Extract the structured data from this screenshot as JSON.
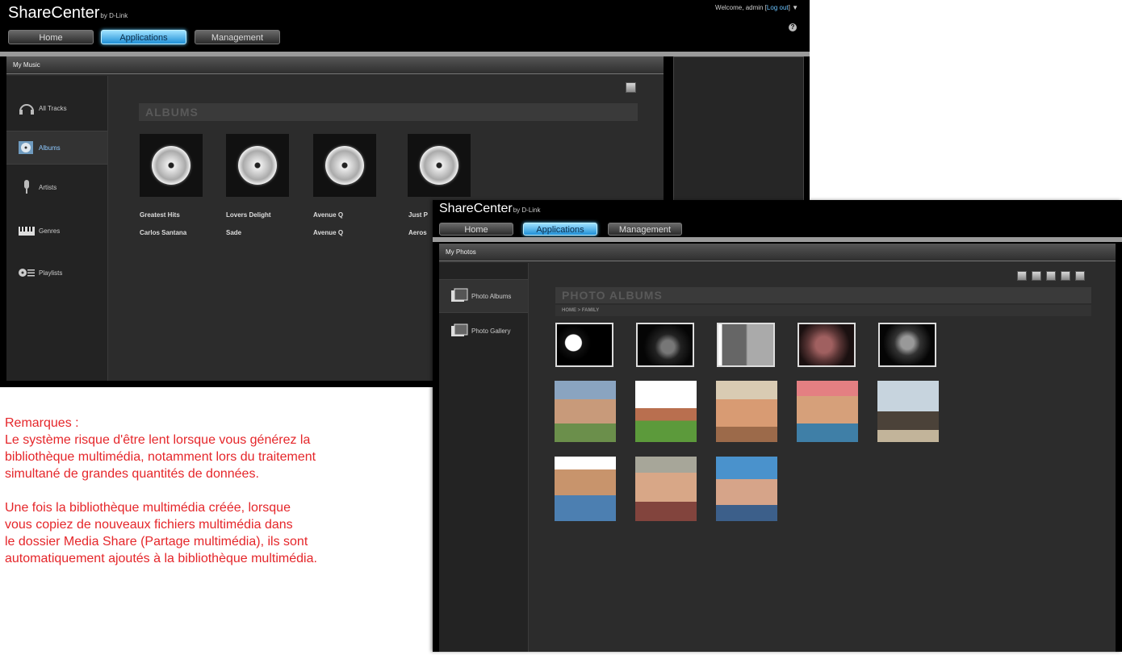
{
  "music_window": {
    "brand": "ShareCenter",
    "brand_sup": "by D-Link",
    "welcome": "Welcome, admin [",
    "logout": "Log out",
    "welcome_end": "] ▼",
    "help_icon": "help-icon",
    "nav": [
      "Home",
      "Applications",
      "Management"
    ],
    "panel_title": "My Music",
    "sidebar": [
      {
        "label": "All Tracks",
        "icon": "headphones-icon"
      },
      {
        "label": "Albums",
        "icon": "cd-icon"
      },
      {
        "label": "Artists",
        "icon": "microphone-icon"
      },
      {
        "label": "Genres",
        "icon": "piano-icon"
      },
      {
        "label": "Playlists",
        "icon": "playlist-icon"
      }
    ],
    "section": "ALBUMS",
    "albums": [
      {
        "title": "Greatest Hits",
        "artist": "Carlos Santana"
      },
      {
        "title": "Lovers Delight",
        "artist": "Sade"
      },
      {
        "title": "Avenue Q",
        "artist": "Avenue Q"
      },
      {
        "title": "Just P",
        "artist": "Aeros"
      }
    ]
  },
  "photo_window": {
    "brand": "ShareCenter",
    "brand_sup": "by D-Link",
    "nav": [
      "Home",
      "Applications",
      "Management"
    ],
    "panel_title": "My Photos",
    "sidebar": [
      {
        "label": "Photo Albums",
        "icon": "photo-albums-icon"
      },
      {
        "label": "Photo Gallery",
        "icon": "photo-gallery-icon"
      }
    ],
    "section": "PHOTO ALBUMS",
    "breadcrumb": "HOME > FAMILY"
  },
  "notes": {
    "title": "Remarques :",
    "para1": [
      "Le système  risque  d'être lent lorsque vous  générez  la",
      "bibliothèque multimédia, notamment lors du traitement",
      "simultané de grandes quantités de données."
    ],
    "para2": [
      "Une  fois  la  bibliothèque multimédia  créée,  lorsque",
      "vous  copiez  de  nouveaux  fichiers  multimédia  dans",
      "le  dossier  Media Share (Partage multimédia), ils  sont",
      "automatiquement ajoutés à la bibliothèque multimédia."
    ]
  },
  "colors": {
    "accent": "#1f8fd6",
    "note_text": "#e5262a"
  }
}
